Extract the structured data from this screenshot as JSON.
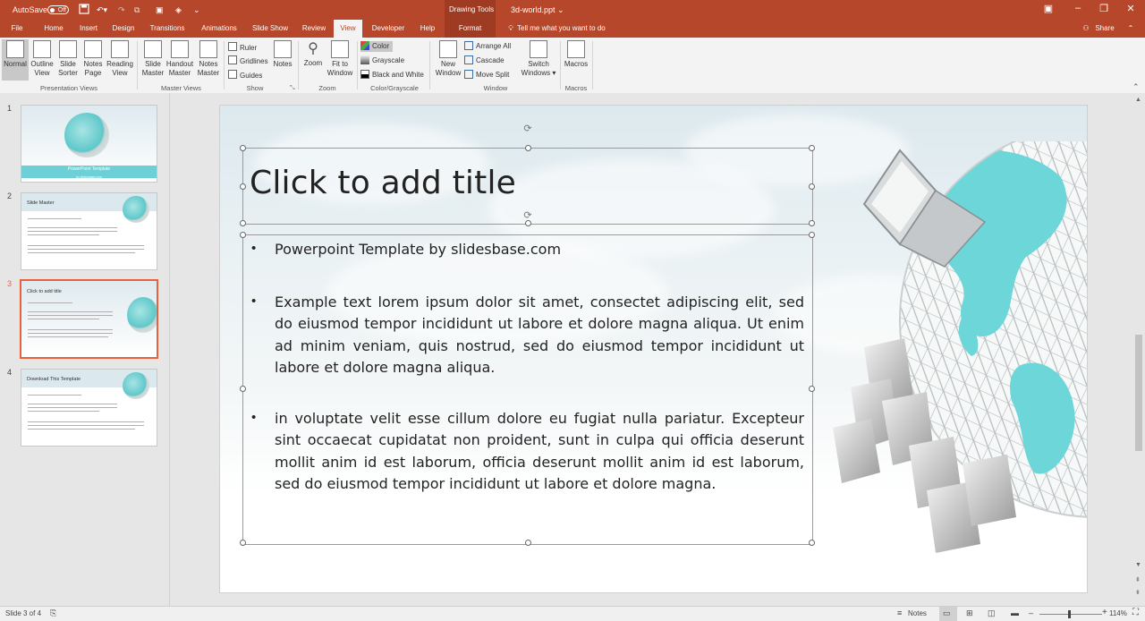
{
  "titlebar": {
    "autosave_label": "AutoSave",
    "autosave_state": "Off",
    "context_group": "Drawing Tools",
    "document_title": "3d-world.ppt",
    "window_buttons": [
      "restore-icon",
      "minimize-icon",
      "maximize-icon",
      "close-icon"
    ]
  },
  "tabs": [
    "File",
    "Home",
    "Insert",
    "Design",
    "Transitions",
    "Animations",
    "Slide Show",
    "Review",
    "View",
    "Developer",
    "Help",
    "Format"
  ],
  "active_tab": "View",
  "tell_me": "Tell me what you want to do",
  "share_label": "Share",
  "ribbon": {
    "presentation_views": {
      "label": "Presentation Views",
      "buttons": [
        {
          "line1": "Normal",
          "line2": ""
        },
        {
          "line1": "Outline",
          "line2": "View"
        },
        {
          "line1": "Slide",
          "line2": "Sorter"
        },
        {
          "line1": "Notes",
          "line2": "Page"
        },
        {
          "line1": "Reading",
          "line2": "View"
        }
      ]
    },
    "master_views": {
      "label": "Master Views",
      "buttons": [
        {
          "line1": "Slide",
          "line2": "Master"
        },
        {
          "line1": "Handout",
          "line2": "Master"
        },
        {
          "line1": "Notes",
          "line2": "Master"
        }
      ]
    },
    "show": {
      "label": "Show",
      "ruler": "Ruler",
      "gridlines": "Gridlines",
      "guides": "Guides",
      "notes": "Notes"
    },
    "zoom": {
      "label": "Zoom",
      "zoom": "Zoom",
      "fit_line1": "Fit to",
      "fit_line2": "Window"
    },
    "color_grayscale": {
      "label": "Color/Grayscale",
      "color": "Color",
      "grayscale": "Grayscale",
      "bw": "Black and White"
    },
    "window": {
      "label": "Window",
      "new_line1": "New",
      "new_line2": "Window",
      "arrange_all": "Arrange All",
      "cascade": "Cascade",
      "move_split": "Move Split",
      "switch_line1": "Switch",
      "switch_line2": "Windows"
    },
    "macros": {
      "label": "Macros",
      "macros": "Macros"
    }
  },
  "thumbnails": [
    {
      "number": "1",
      "title": "PowerPoint Template",
      "subtitle": "by slidesbase.com"
    },
    {
      "number": "2",
      "title": "Slide Master"
    },
    {
      "number": "3",
      "title": "Click to add title"
    },
    {
      "number": "4",
      "title": "Download This Template"
    }
  ],
  "slide": {
    "title_placeholder": "Click to add title",
    "bullets": [
      "Powerpoint Template by slidesbase.com",
      "Example text lorem ipsum dolor sit amet, consectet adipiscing elit, sed do eiusmod tempor incididunt ut labore et dolore magna aliqua. Ut enim ad minim veniam, quis nostrud, sed do eiusmod tempor incididunt ut labore et dolore magna aliqua.",
      "in voluptate velit esse cillum dolore eu fugiat nulla pariatur. Excepteur sint occaecat cupidatat non proident, sunt in culpa qui officia deserunt mollit anim id est laborum, officia deserunt mollit anim id est laborum, sed do eiusmod tempor incididunt ut labore et dolore magna."
    ]
  },
  "statusbar": {
    "slide_info": "Slide 3 of 4",
    "notes_label": "Notes",
    "zoom_level": "114%"
  },
  "colors": {
    "accent": "#b7472a",
    "selected_thumb": "#e8613c",
    "globe": "#6cd6d9"
  }
}
